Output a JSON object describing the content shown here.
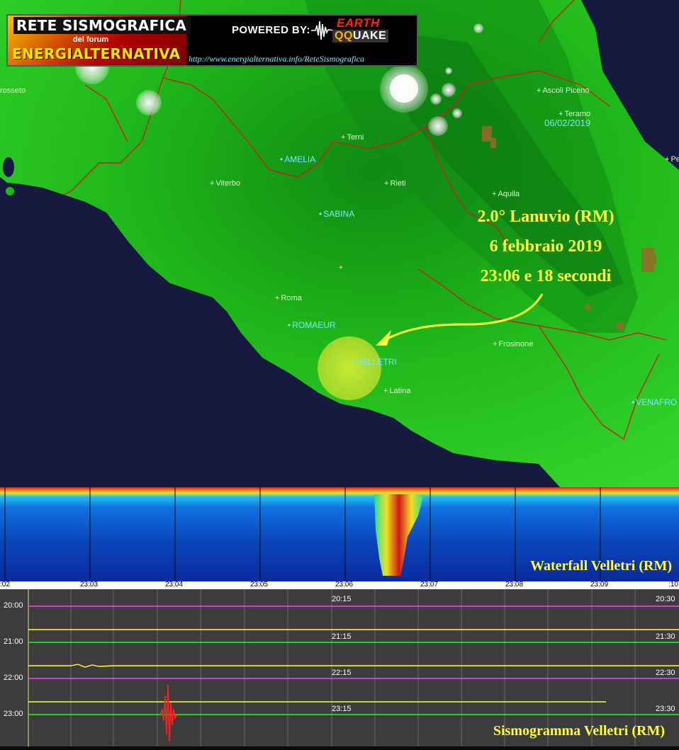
{
  "banner": {
    "title": "RETE SISMOGRAFICA",
    "subtitle": "del forum",
    "name": "ENERGIALTERNATIVA",
    "powered_by": "POWERED BY:",
    "logo_earth": "EARTH",
    "logo_quake_qq": "QQ",
    "logo_quake_rest": "UAKE",
    "url": "http://www.energialternativa.info/ReteSismografica"
  },
  "map": {
    "date": "06/02/2019",
    "cities": [
      {
        "name": "rosseto",
        "id": "grosseto"
      },
      {
        "name": "Ascoli Piceno",
        "id": "ascoli-piceno"
      },
      {
        "name": "Teramo",
        "id": "teramo"
      },
      {
        "name": "Terni",
        "id": "terni"
      },
      {
        "name": "Viterbo",
        "id": "viterbo"
      },
      {
        "name": "Rieti",
        "id": "rieti"
      },
      {
        "name": "Pescara",
        "id": "pescara"
      },
      {
        "name": "Aquila",
        "id": "aquila"
      },
      {
        "name": "Roma",
        "id": "roma"
      },
      {
        "name": "Frosinone",
        "id": "frosinone"
      },
      {
        "name": "Latina",
        "id": "latina"
      }
    ],
    "stations": [
      {
        "name": "AMELIA",
        "id": "amelia"
      },
      {
        "name": "SABINA",
        "id": "sabina"
      },
      {
        "name": "ROMAEUR",
        "id": "romaeur"
      },
      {
        "name": "VELLETRI",
        "id": "velletri"
      },
      {
        "name": "VENAFRO",
        "id": "venafro"
      }
    ],
    "colors": {
      "land": "#1fb81a",
      "sea": "#151a3e",
      "border": "#c82020",
      "event": "#f0f020"
    }
  },
  "event": {
    "line1": "2.0° Lanuvio (RM)",
    "line2": "6 febbraio 2019",
    "line3": "23:06 e 18 secondi"
  },
  "waterfall": {
    "label": "Waterfall Velletri (RM)",
    "time_labels": [
      ":02",
      "23:03",
      "23:04",
      "23:05",
      "23:06",
      "23:07",
      "23:08",
      "23:09",
      ":10"
    ]
  },
  "seismogram": {
    "label": "Sismogramma Velletri (RM)",
    "hour_labels": [
      "20:00",
      "21:00",
      "22:00",
      "23:00"
    ],
    "mark_labels_mid": [
      "20:15",
      "21:15",
      "22:15",
      "23:15"
    ],
    "mark_labels_end": [
      "20:30",
      "21:30",
      "22:30",
      "23:30"
    ],
    "trace_colors": [
      "#ff40ff",
      "#20ff20",
      "#ffff40",
      "#ff2020"
    ]
  }
}
